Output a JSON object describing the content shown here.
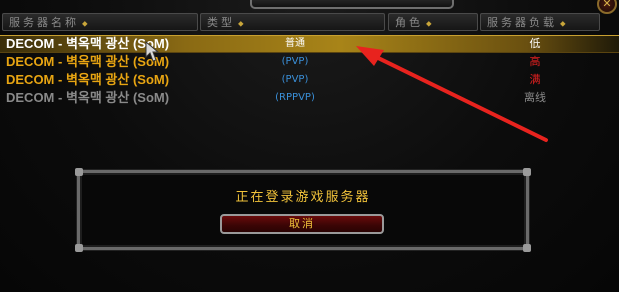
{
  "columns": {
    "name": "服务器名称",
    "type": "类型",
    "color": "角色",
    "load": "服务器负载",
    "sort_arrow": "⬥"
  },
  "servers": [
    {
      "name": "DECOM - 벽옥맥 광산 (SoM)",
      "type": "普通",
      "load": "低",
      "name_color": "#ffffff",
      "type_color": "#ffffff",
      "load_color": "#ffffff",
      "selected": true
    },
    {
      "name": "DECOM - 벽옥맥 광산 (SoM)",
      "type": "(PVP)",
      "load": "高",
      "name_color": "#e8a512",
      "type_color": "#3a8fd8",
      "load_color": "#e02020",
      "selected": false
    },
    {
      "name": "DECOM - 벽옥맥 광산 (SoM)",
      "type": "(PVP)",
      "load": "满",
      "name_color": "#e8a512",
      "type_color": "#3a8fd8",
      "load_color": "#e02020",
      "selected": false
    },
    {
      "name": "DECOM - 벽옥맥 광산 (SoM)",
      "type": "(RPPVP)",
      "load": "离线",
      "name_color": "#8a8a8a",
      "type_color": "#3a8fd8",
      "load_color": "#8a8a8a",
      "selected": false
    }
  ],
  "dialog": {
    "message": "正在登录游戏服务器",
    "cancel_label": "取消"
  },
  "close_icon": "✕",
  "colors": {
    "accent_gold": "#f0c23a",
    "annotation_arrow": "#e8231e"
  }
}
